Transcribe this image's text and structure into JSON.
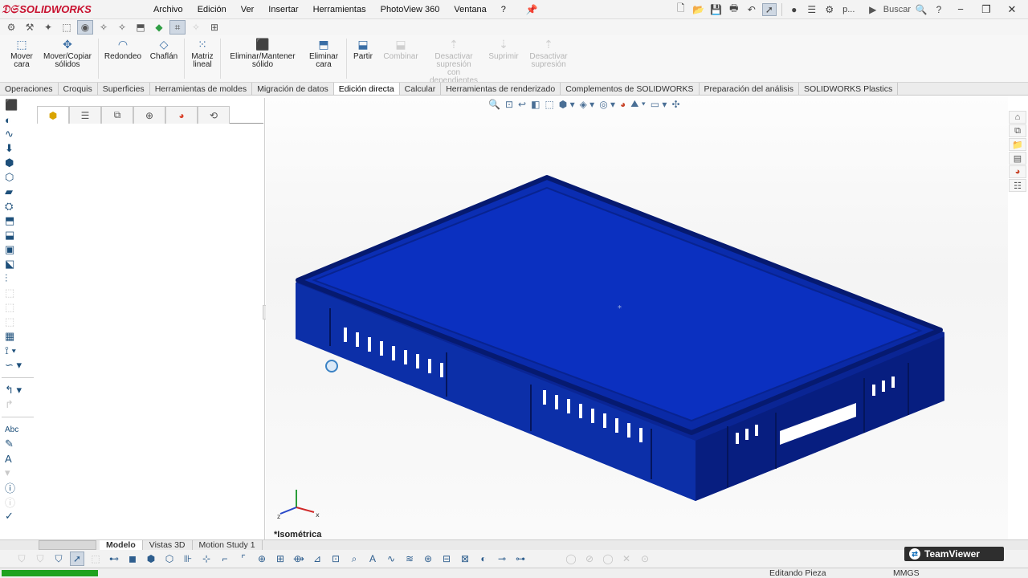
{
  "app": {
    "logo_text": "SOLIDWORKS",
    "menu": [
      "Archivo",
      "Edición",
      "Ver",
      "Insertar",
      "Herramientas",
      "PhotoView 360",
      "Ventana",
      "?"
    ],
    "search_placeholder": "Buscar",
    "quick_label": "p..."
  },
  "ribbon": {
    "commands": [
      {
        "label": "Mover cara",
        "icon": "move-face-icon",
        "enabled": true
      },
      {
        "label": "Mover/Copiar sólidos",
        "icon": "move-copy-bodies-icon",
        "enabled": true
      },
      {
        "label": "Redondeo",
        "icon": "fillet-icon",
        "enabled": true
      },
      {
        "label": "Chaflán",
        "icon": "chamfer-icon",
        "enabled": true
      },
      {
        "label": "Matriz lineal",
        "icon": "linear-pattern-icon",
        "enabled": true
      },
      {
        "label": "Eliminar/Mantener sólido",
        "icon": "delete-keep-body-icon",
        "enabled": true
      },
      {
        "label": "Eliminar cara",
        "icon": "delete-face-icon",
        "enabled": true
      },
      {
        "label": "Partir",
        "icon": "split-icon",
        "enabled": true
      },
      {
        "label": "Combinar",
        "icon": "combine-icon",
        "enabled": false
      },
      {
        "label": "Desactivar supresión con dependientes",
        "icon": "unsuppress-dependents-icon",
        "enabled": false
      },
      {
        "label": "Suprimir",
        "icon": "suppress-icon",
        "enabled": false
      },
      {
        "label": "Desactivar supresión",
        "icon": "unsuppress-icon",
        "enabled": false
      }
    ]
  },
  "tabs": {
    "items": [
      "Operaciones",
      "Croquis",
      "Superficies",
      "Herramientas de moldes",
      "Migración de datos",
      "Edición directa",
      "Calcular",
      "Herramientas de renderizado",
      "Complementos de SOLIDWORKS",
      "Preparación del análisis",
      "SOLIDWORKS Plastics"
    ],
    "active": "Edición directa"
  },
  "viewport": {
    "orientation_label": "*Isométrica",
    "model_color": "#0a2fb0",
    "model_dark": "#061c73"
  },
  "bottom_tabs": {
    "items": [
      "Modelo",
      "Vistas 3D",
      "Motion Study 1"
    ],
    "active": "Modelo"
  },
  "status": {
    "state": "Editando Pieza",
    "units": "MMGS",
    "progress": 1.0
  },
  "overlay": {
    "teamviewer": "TeamViewer"
  }
}
